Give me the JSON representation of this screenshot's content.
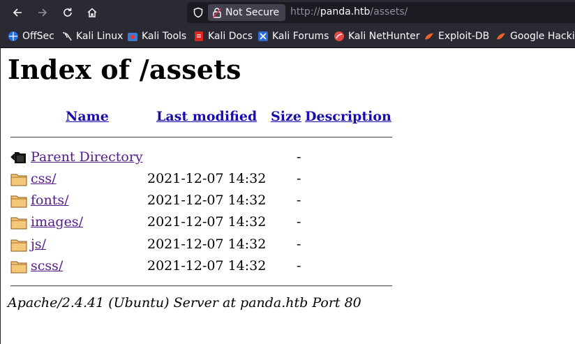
{
  "browser": {
    "security_label": "Not Secure",
    "url_scheme": "http://",
    "url_host": "panda.htb",
    "url_path": "/assets/",
    "bookmarks": [
      {
        "label": "OffSec",
        "icon": "offsec-icon"
      },
      {
        "label": "Kali Linux",
        "icon": "kali-dragon-icon"
      },
      {
        "label": "Kali Tools",
        "icon": "kali-tools-icon"
      },
      {
        "label": "Kali Docs",
        "icon": "kali-docs-icon"
      },
      {
        "label": "Kali Forums",
        "icon": "kali-forums-icon"
      },
      {
        "label": "Kali NetHunter",
        "icon": "nethunter-icon"
      },
      {
        "label": "Exploit-DB",
        "icon": "exploitdb-icon"
      },
      {
        "label": "Google Hackin",
        "icon": "ghdb-icon"
      }
    ]
  },
  "page": {
    "title": "Index of /assets",
    "columns": {
      "name": "Name",
      "last_modified": "Last modified",
      "size": "Size",
      "description": "Description"
    },
    "rows": [
      {
        "name": "Parent Directory",
        "modified": "",
        "size": "-",
        "icon": "parent-directory-icon"
      },
      {
        "name": "css/",
        "modified": "2021-12-07 14:32",
        "size": "-",
        "icon": "folder-icon"
      },
      {
        "name": "fonts/",
        "modified": "2021-12-07 14:32",
        "size": "-",
        "icon": "folder-icon"
      },
      {
        "name": "images/",
        "modified": "2021-12-07 14:32",
        "size": "-",
        "icon": "folder-icon"
      },
      {
        "name": "js/",
        "modified": "2021-12-07 14:32",
        "size": "-",
        "icon": "folder-icon"
      },
      {
        "name": "scss/",
        "modified": "2021-12-07 14:32",
        "size": "-",
        "icon": "folder-icon"
      }
    ],
    "footer": "Apache/2.4.41 (Ubuntu) Server at panda.htb Port 80"
  }
}
